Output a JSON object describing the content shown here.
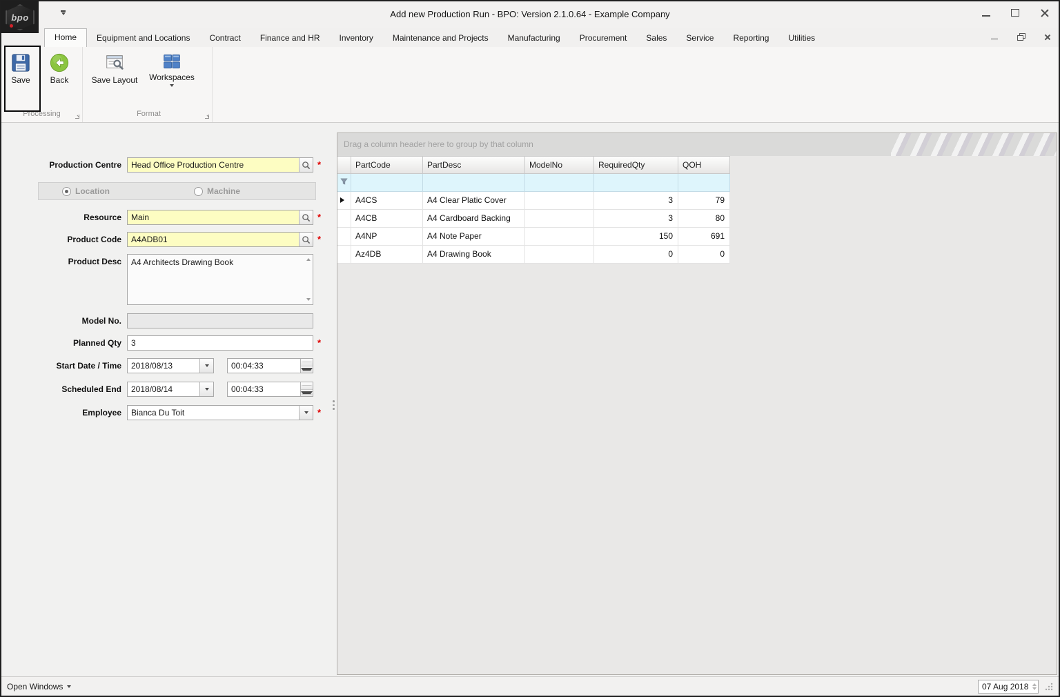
{
  "window": {
    "title": "Add new Production Run - BPO: Version 2.1.0.64 - Example Company",
    "logo_text": "bpo"
  },
  "ribbon": {
    "tabs": [
      "Home",
      "Equipment and Locations",
      "Contract",
      "Finance and HR",
      "Inventory",
      "Maintenance and Projects",
      "Manufacturing",
      "Procurement",
      "Sales",
      "Service",
      "Reporting",
      "Utilities"
    ],
    "active_tab": "Home",
    "buttons": {
      "save": "Save",
      "back": "Back",
      "save_layout": "Save Layout",
      "workspaces": "Workspaces"
    },
    "groups": {
      "processing": "Processing",
      "format": "Format"
    }
  },
  "form": {
    "production_centre_label": "Production Centre",
    "production_centre_value": "Head Office Production Centre",
    "location_label": "Location",
    "machine_label": "Machine",
    "resource_label": "Resource",
    "resource_value": "Main",
    "product_code_label": "Product Code",
    "product_code_value": "A4ADB01",
    "product_desc_label": "Product Desc",
    "product_desc_value": "A4 Architects Drawing Book",
    "model_no_label": "Model No.",
    "model_no_value": "",
    "planned_qty_label": "Planned Qty",
    "planned_qty_value": "3",
    "start_label": "Start Date / Time",
    "start_date_value": "2018/08/13",
    "start_time_value": "00:04:33",
    "end_label": "Scheduled End",
    "end_date_value": "2018/08/14",
    "end_time_value": "00:04:33",
    "employee_label": "Employee",
    "employee_value": "Bianca Du Toit"
  },
  "grid": {
    "group_hint": "Drag a column header here to group by that column",
    "columns": [
      "PartCode",
      "PartDesc",
      "ModelNo",
      "RequiredQty",
      "QOH"
    ],
    "rows": [
      [
        "A4CS",
        "A4 Clear Platic Cover",
        "",
        "3",
        "79"
      ],
      [
        "A4CB",
        "A4 Cardboard Backing",
        "",
        "3",
        "80"
      ],
      [
        "A4NP",
        "A4 Note Paper",
        "",
        "150",
        "691"
      ],
      [
        "Az4DB",
        "A4 Drawing Book",
        "",
        "0",
        "0"
      ]
    ]
  },
  "statusbar": {
    "open_windows_label": "Open Windows",
    "date_value": "07 Aug 2018"
  },
  "colors": {
    "required_field_bg": "#fdfdc2",
    "filter_row_bg": "#def5fc",
    "save_icon_blue": "#3e69a8",
    "back_icon_green": "#8bc53f",
    "required_asterisk": "#e00000",
    "highlight_annotation": "#0a0a0a"
  }
}
